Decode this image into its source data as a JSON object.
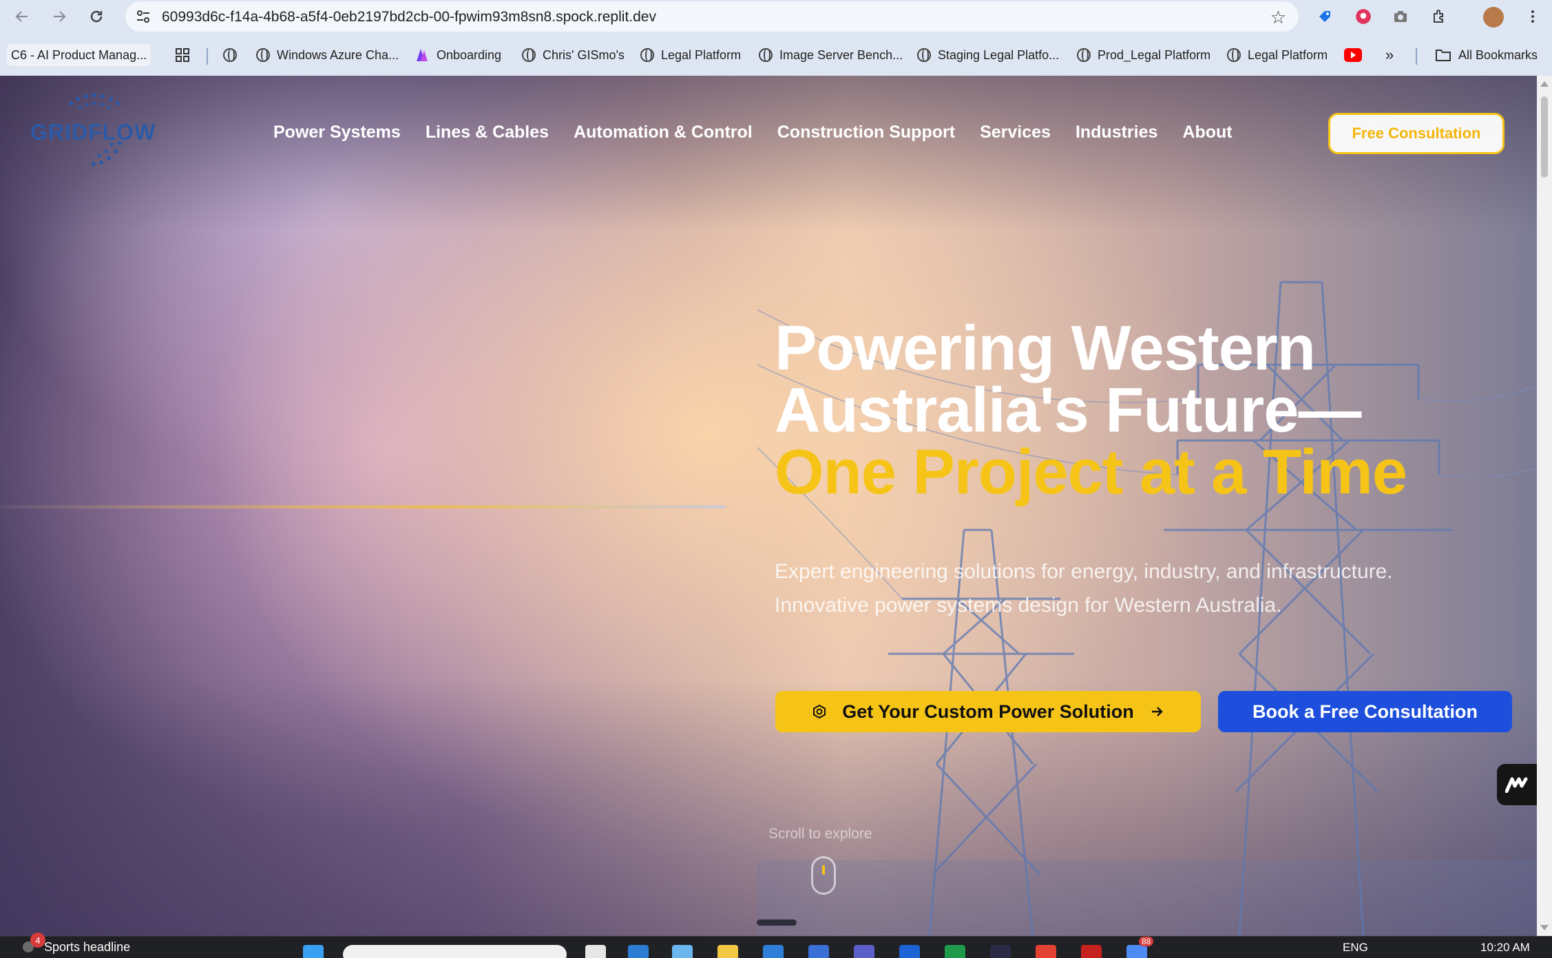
{
  "browser": {
    "url": "60993d6c-f14a-4b68-a5f4-0eb2197bd2cb-00-fpwim93m8sn8.spock.replit.dev",
    "bookmarks": [
      {
        "label": "C6 - AI Product Manag...",
        "icon": "tab-icon"
      },
      {
        "label": "Windows Azure Cha...",
        "icon": "globe-icon"
      },
      {
        "label": "Onboarding",
        "icon": "onboarding-icon"
      },
      {
        "label": "Chris' GISmo's",
        "icon": "globe-icon"
      },
      {
        "label": "Legal Platform",
        "icon": "globe-icon"
      },
      {
        "label": "Image Server Bench...",
        "icon": "globe-icon"
      },
      {
        "label": "Staging Legal Platfo...",
        "icon": "globe-icon"
      },
      {
        "label": "Prod_Legal Platform",
        "icon": "globe-icon"
      },
      {
        "label": "Legal Platform",
        "icon": "globe-icon"
      }
    ],
    "more_bookmarks": "»",
    "all_bookmarks": "All Bookmarks"
  },
  "site": {
    "logo_text": "GRIDFLOW",
    "nav": [
      "Power Systems",
      "Lines & Cables",
      "Automation & Control",
      "Construction Support",
      "Services",
      "Industries",
      "About"
    ],
    "cta_top": "Free Consultation"
  },
  "hero": {
    "line1": "Powering Western",
    "line2": "Australia's Future—",
    "line3": "One Project at a Time",
    "sub1": "Expert engineering solutions for energy, industry, and infrastructure.",
    "sub2": "Innovative power systems design for Western Australia.",
    "btn_primary": "Get Your Custom Power Solution",
    "btn_secondary": "Book a Free Consultation",
    "scroll_hint": "Scroll to explore"
  },
  "taskbar": {
    "news_badge": "4",
    "news": "Sports headline",
    "language": "ENG",
    "time": "10:20 AM",
    "notif_count": "88"
  },
  "colors": {
    "accent_yellow": "#f6c417",
    "accent_blue": "#1d4fdc",
    "logo_blue": "#2c5aa6"
  }
}
